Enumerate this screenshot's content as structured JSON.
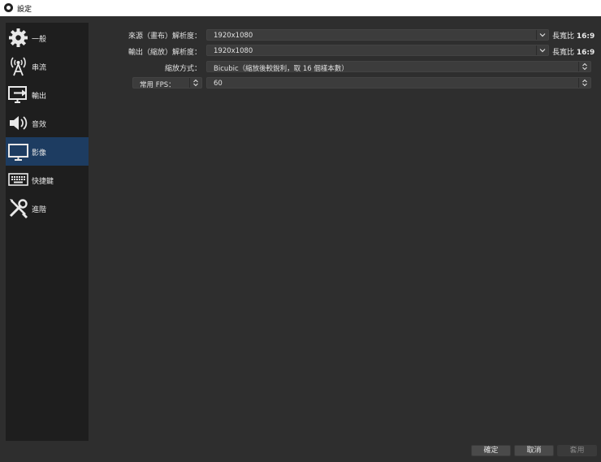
{
  "window": {
    "title": "設定"
  },
  "sidebar": {
    "items": [
      {
        "label": "一般",
        "icon": "gear-icon"
      },
      {
        "label": "串流",
        "icon": "broadcast-antenna-icon"
      },
      {
        "label": "輸出",
        "icon": "output-monitor-icon"
      },
      {
        "label": "音效",
        "icon": "speaker-icon"
      },
      {
        "label": "影像",
        "icon": "monitor-icon",
        "selected": true
      },
      {
        "label": "快捷鍵",
        "icon": "keyboard-icon"
      },
      {
        "label": "進階",
        "icon": "wrench-screwdriver-icon"
      }
    ]
  },
  "video": {
    "base_label": "來源（畫布）解析度：",
    "base_value": "1920x1080",
    "base_aspect_prefix": "長寬比",
    "base_aspect_value": "16:9",
    "output_label": "輸出（縮放）解析度：",
    "output_value": "1920x1080",
    "output_aspect_prefix": "長寬比",
    "output_aspect_value": "16:9",
    "filter_label": "縮放方式：",
    "filter_value": "Bicubic（縮放後較銳利，取 16 個樣本數）",
    "fps_type_value": "常用 FPS：",
    "fps_value": "60"
  },
  "buttons": {
    "ok": "確定",
    "cancel": "取消",
    "apply": "套用"
  },
  "colors": {
    "selected_bg": "#1d3c61",
    "window_bg": "#2e2e2e",
    "sidebar_bg": "#1e1e1e"
  }
}
